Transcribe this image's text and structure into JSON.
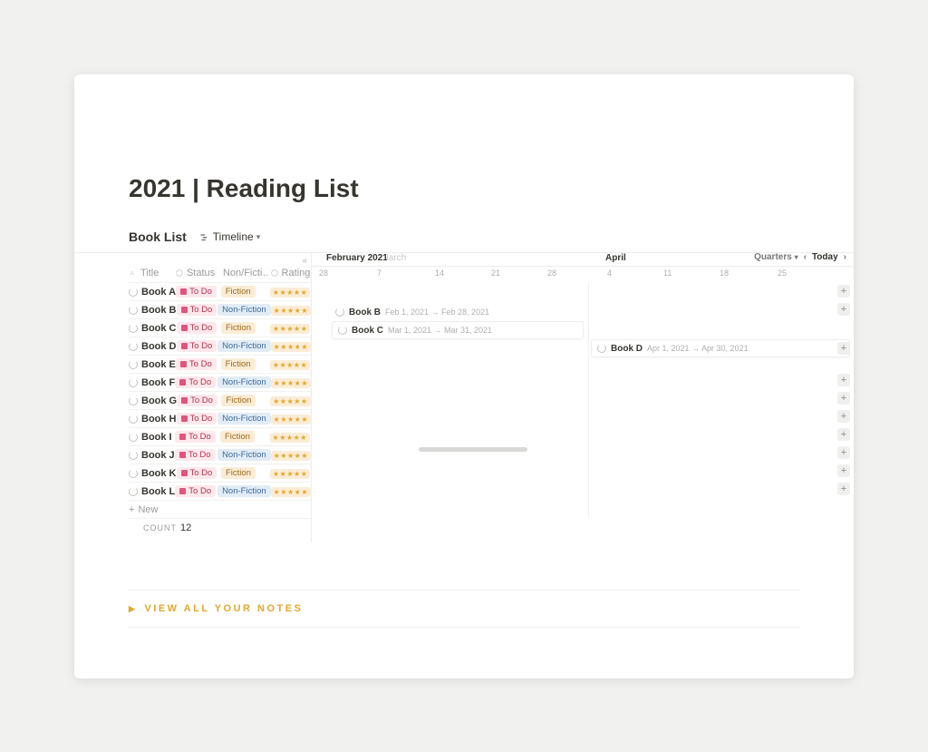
{
  "page": {
    "title": "2021 | Reading List"
  },
  "db": {
    "title": "Book List",
    "view_label": "Timeline",
    "new_label": "New",
    "count_label": "COUNT",
    "count_value": "12"
  },
  "columns": {
    "title": "Title",
    "status": "Status",
    "nonfi": "Non/Ficti…",
    "rating": "Rating"
  },
  "tags": {
    "todo": "To Do",
    "fiction": "Fiction",
    "nonfiction": "Non-Fiction",
    "stars5": "★★★★★"
  },
  "rows": [
    {
      "name": "Book A",
      "status": "todo",
      "type": "fiction"
    },
    {
      "name": "Book B",
      "status": "todo",
      "type": "nonfiction"
    },
    {
      "name": "Book C",
      "status": "todo",
      "type": "fiction"
    },
    {
      "name": "Book D",
      "status": "todo",
      "type": "nonfiction"
    },
    {
      "name": "Book E",
      "status": "todo",
      "type": "fiction"
    },
    {
      "name": "Book F",
      "status": "todo",
      "type": "nonfiction"
    },
    {
      "name": "Book G",
      "status": "todo",
      "type": "fiction"
    },
    {
      "name": "Book H",
      "status": "todo",
      "type": "nonfiction"
    },
    {
      "name": "Book I",
      "status": "todo",
      "type": "fiction"
    },
    {
      "name": "Book J",
      "status": "todo",
      "type": "nonfiction"
    },
    {
      "name": "Book K",
      "status": "todo",
      "type": "fiction"
    },
    {
      "name": "Book L",
      "status": "todo",
      "type": "nonfiction"
    }
  ],
  "timeline": {
    "months": {
      "feb": "February 2021",
      "mar": "Iarch",
      "apr": "April"
    },
    "days": [
      "28",
      "7",
      "14",
      "21",
      "28",
      "4",
      "11",
      "18",
      "25"
    ],
    "controls": {
      "scale": "Quarters",
      "today": "Today"
    },
    "bars": {
      "b": {
        "name": "Book B",
        "date": "Feb 1, 2021 → Feb 28, 2021"
      },
      "c": {
        "name": "Book C",
        "date": "Mar 1, 2021 → Mar 31, 2021"
      },
      "d": {
        "name": "Book D",
        "date": "Apr 1, 2021 → Apr 30, 2021"
      }
    }
  },
  "footer": {
    "view_notes": "VIEW ALL YOUR NOTES"
  }
}
